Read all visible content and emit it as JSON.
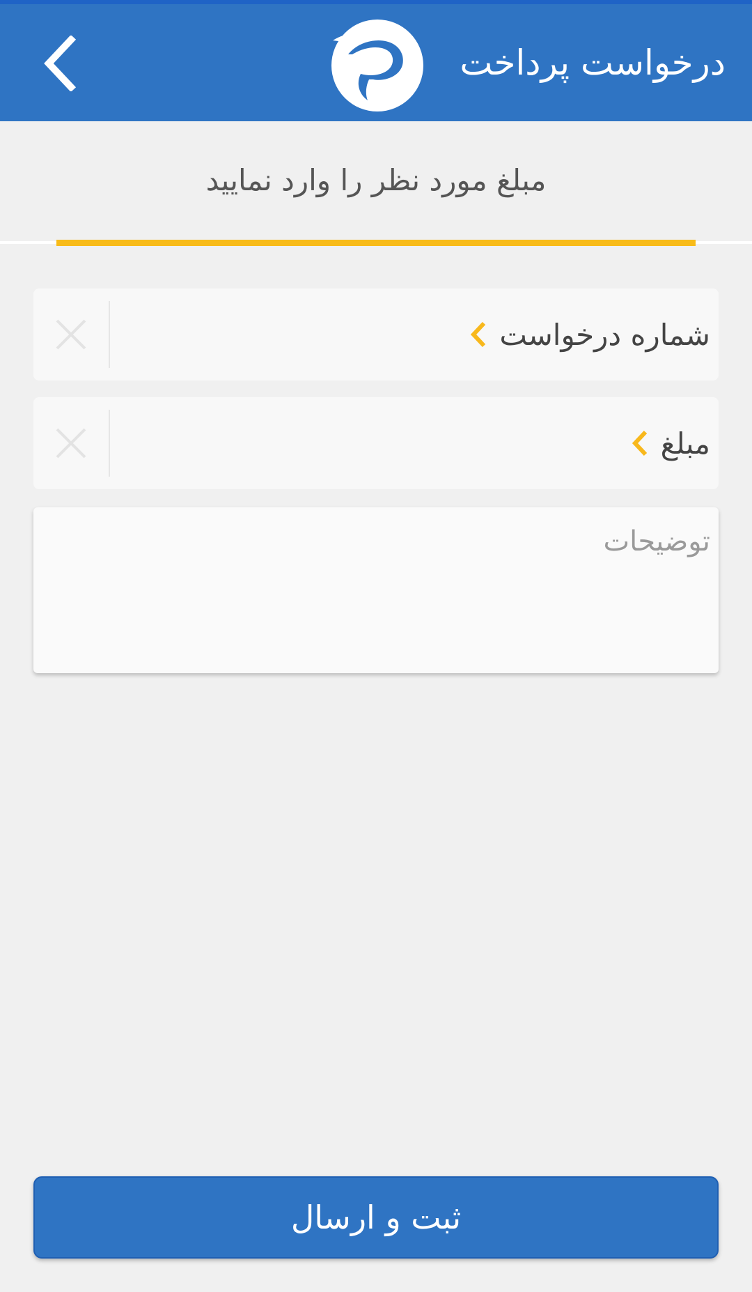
{
  "appbar": {
    "title": "درخواست پرداخت",
    "back_icon": "chevron-left-icon",
    "logo_icon": "app-logo-icon",
    "background": "#2f74c3"
  },
  "tabs": {
    "active_label": "مبلغ مورد نظر را وارد نمایید",
    "indicator_color": "#f8bb19"
  },
  "form": {
    "request_number": {
      "label": "شماره درخواست",
      "value": "",
      "chevron_icon": "chevron-left-icon",
      "clear_icon": "close-icon"
    },
    "amount": {
      "label": "مبلغ",
      "value": "",
      "chevron_icon": "chevron-left-icon",
      "clear_icon": "close-icon"
    },
    "description": {
      "placeholder": "توضیحات",
      "value": ""
    }
  },
  "submit": {
    "label": "ثبت و ارسال"
  }
}
